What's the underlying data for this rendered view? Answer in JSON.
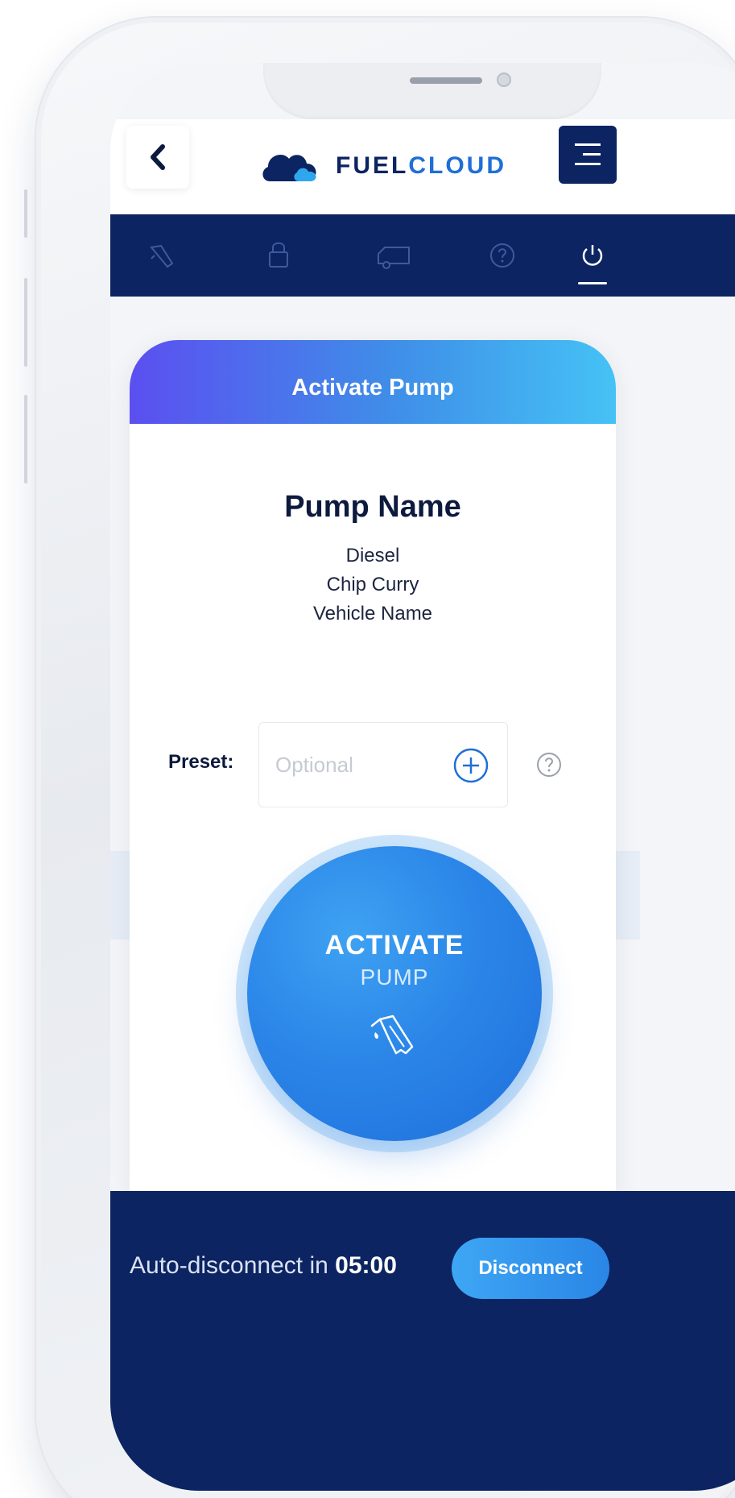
{
  "header": {
    "back_icon": "chevron-left-icon",
    "logo": {
      "icon": "cloud-icon",
      "text_part1": "FUEL",
      "text_part2": "CLOUD"
    },
    "menu_icon": "hamburger-menu-icon"
  },
  "nav": {
    "items": [
      {
        "icon": "fuel-nozzle-icon",
        "active": false
      },
      {
        "icon": "lock-icon",
        "active": false
      },
      {
        "icon": "truck-icon",
        "active": false
      },
      {
        "icon": "help-circle-icon",
        "active": false
      },
      {
        "icon": "power-icon",
        "active": true
      }
    ]
  },
  "card": {
    "title": "Activate Pump",
    "pump_name": "Pump Name",
    "lines": [
      "Diesel",
      "Chip Curry",
      "Vehicle Name"
    ],
    "preset": {
      "label": "Preset:",
      "placeholder": "Optional",
      "value": ""
    }
  },
  "activate_button": {
    "line1": "ACTIVATE",
    "line2": "PUMP"
  },
  "footer": {
    "auto_disconnect_text": "Auto-disconnect in ",
    "countdown": "05:00",
    "disconnect_label": "Disconnect"
  },
  "colors": {
    "navy": "#0c2461",
    "accent_blue": "#2a86e6",
    "gradient_start": "#5b4ff0",
    "gradient_end": "#45c2f5"
  }
}
